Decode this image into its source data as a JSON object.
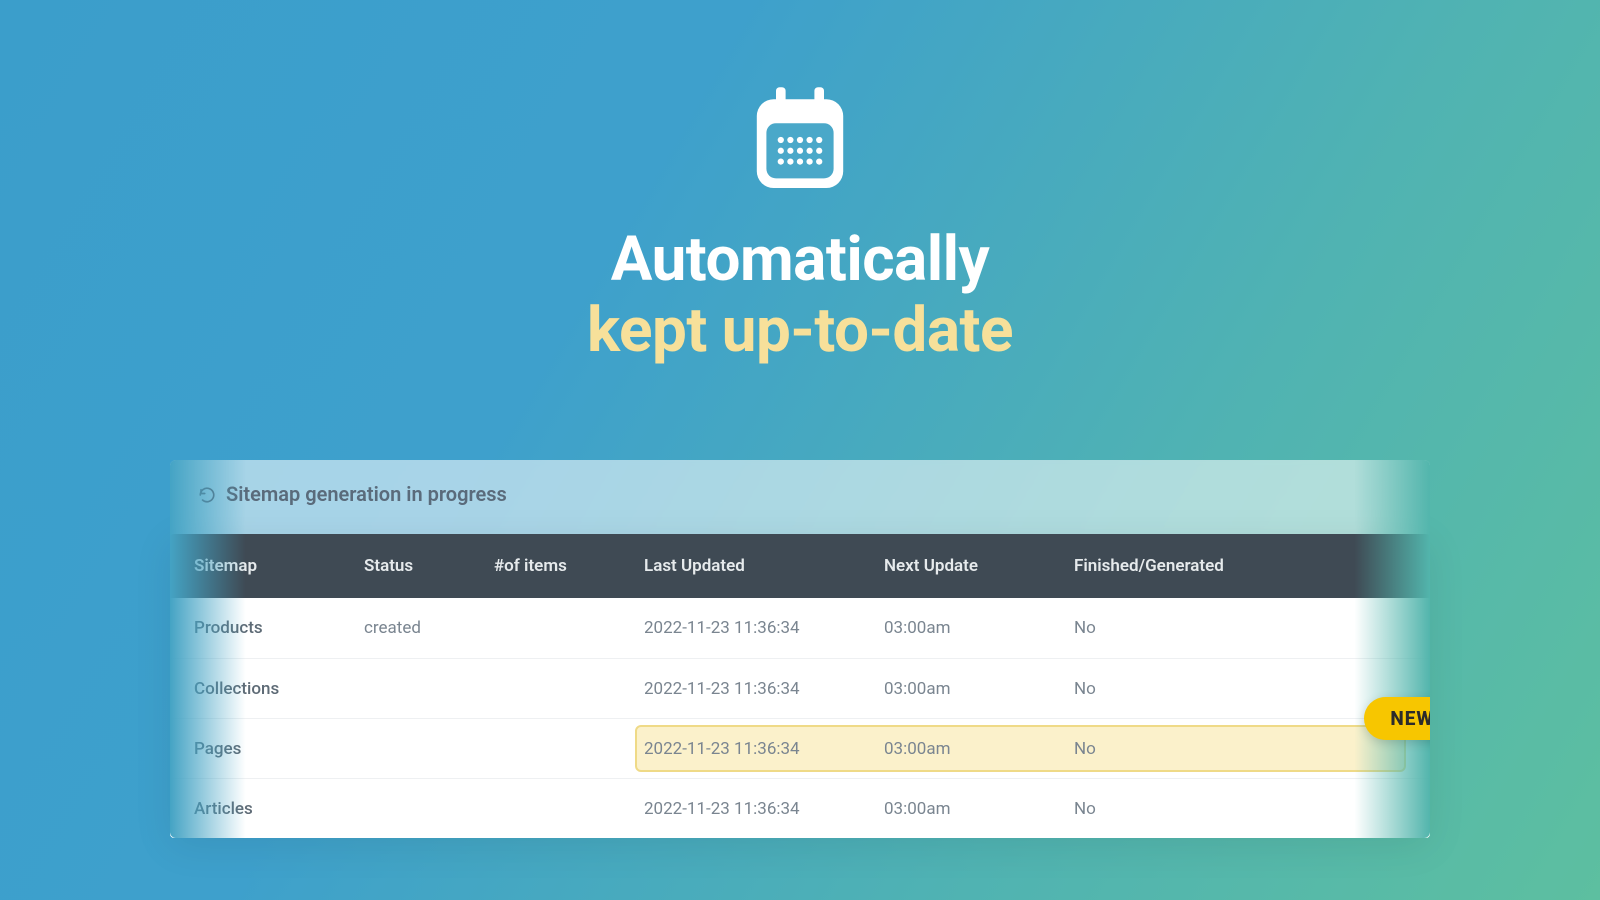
{
  "hero": {
    "line1": "Automatically",
    "line2": "kept up-to-date"
  },
  "status": {
    "text": "Sitemap generation in progress"
  },
  "badge": {
    "new_label": "NEW"
  },
  "table": {
    "headers": {
      "sitemap": "Sitemap",
      "status": "Status",
      "items": "#of items",
      "last_updated": "Last Updated",
      "next_update": "Next Update",
      "finished": "Finished/Generated"
    },
    "rows": [
      {
        "sitemap": "Products",
        "status": "created",
        "items": "",
        "last_updated": "2022-11-23 11:36:34",
        "next_update": "03:00am",
        "finished": "No",
        "highlighted": false
      },
      {
        "sitemap": "Collections",
        "status": "",
        "items": "",
        "last_updated": "2022-11-23 11:36:34",
        "next_update": "03:00am",
        "finished": "No",
        "highlighted": false
      },
      {
        "sitemap": "Pages",
        "status": "",
        "items": "",
        "last_updated": "2022-11-23 11:36:34",
        "next_update": "03:00am",
        "finished": "No",
        "highlighted": true
      },
      {
        "sitemap": "Articles",
        "status": "",
        "items": "",
        "last_updated": "2022-11-23 11:36:34",
        "next_update": "03:00am",
        "finished": "No",
        "highlighted": false
      }
    ]
  }
}
